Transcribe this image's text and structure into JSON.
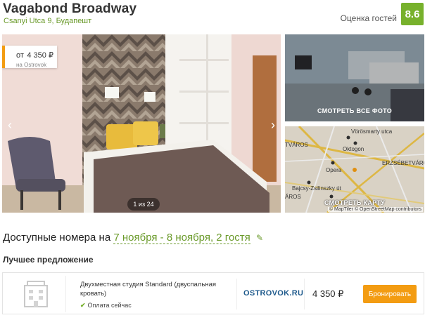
{
  "hotel": {
    "name": "Vagabond Broadway",
    "address": "Csanyi Utca 9, Будапешт",
    "rating_label": "Оценка гостей",
    "rating_value": "8.6"
  },
  "gallery": {
    "price_from": "от",
    "price_value": "4 350 ₽",
    "price_source": "на Ostrovok",
    "counter": "1 из 24",
    "prev_icon": "chevron-left-icon",
    "next_icon": "chevron-right-icon",
    "all_photos_label": "СМОТРЕТЬ ВСЕ ФОТО",
    "map_label": "СМОТРЕТЬ КАРТУ",
    "map_attribution": "© MapTiler © OpenStreetMap contributors",
    "map_places": [
      "Vörösmarty utca",
      "Oktogon",
      "TVÁROS",
      "ERZSÉBETVÁROS",
      "Opera",
      "Bajcsy-Zsilinszky út",
      "ÁROS"
    ]
  },
  "rooms": {
    "heading": "Доступные номера на",
    "dates": "7 ноября - 8 ноября, 2 гостя",
    "edit_icon": "pencil-icon",
    "best_offer_label": "Лучшее предложение"
  },
  "offer": {
    "room_name": "Двухместная студия Standard (двуспальная кровать)",
    "payment": "Оплата сейчас",
    "provider": "OSTROVOK.RU",
    "price": "4 350 ₽",
    "book_label": "Бронировать"
  },
  "colors": {
    "accent_green": "#77b12c",
    "accent_orange": "#f39c12",
    "link_green": "#6a9a2a"
  }
}
